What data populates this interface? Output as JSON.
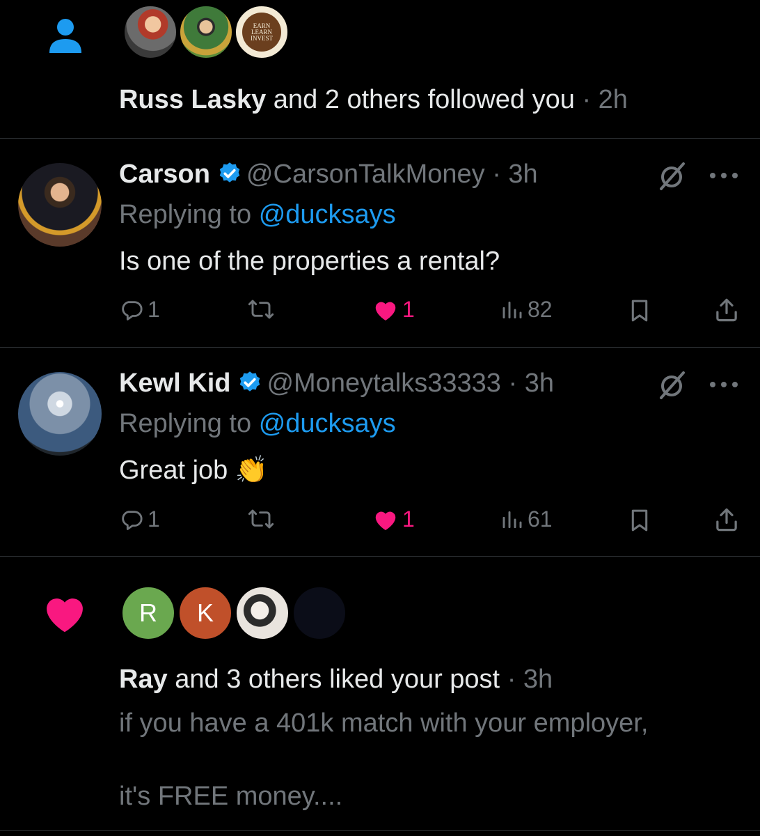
{
  "follow_notification": {
    "actor": "Russ Lasky",
    "text": "and 2 others followed you",
    "separator": "·",
    "time": "2h",
    "avatar3_label": "EARN LEARN INVEST"
  },
  "replies": [
    {
      "name": "Carson",
      "handle": "@CarsonTalkMoney",
      "separator": "·",
      "time": "3h",
      "replying_label": "Replying to",
      "replying_handle": "@ducksays",
      "body": "Is one of the properties a rental?",
      "emoji": "",
      "replies_count": "1",
      "likes_count": "1",
      "views_count": "82"
    },
    {
      "name": "Kewl Kid",
      "handle": "@Moneytalks33333",
      "separator": "·",
      "time": "3h",
      "replying_label": "Replying to",
      "replying_handle": "@ducksays",
      "body": "Great job",
      "emoji": "👏",
      "replies_count": "1",
      "likes_count": "1",
      "views_count": "61"
    }
  ],
  "like_notification": {
    "actor": "Ray",
    "text": "and 3 others liked your post",
    "separator": "·",
    "time": "3h",
    "avatar_letters": [
      "R",
      "K"
    ],
    "post_line1": "if you have a 401k match with your employer,",
    "post_line2": "it's FREE money...."
  },
  "colors": {
    "background": "#000000",
    "accent": "#1d9bf0",
    "like": "#f91880",
    "muted": "#71767b",
    "divider": "#2f3336",
    "avatar_r": "#6aa84f",
    "avatar_k": "#c0502a"
  },
  "icons": [
    "person-icon",
    "verified-icon",
    "grok-icon",
    "more-icon",
    "reply-icon",
    "retweet-icon",
    "heart-icon",
    "views-icon",
    "bookmark-icon",
    "share-icon"
  ]
}
